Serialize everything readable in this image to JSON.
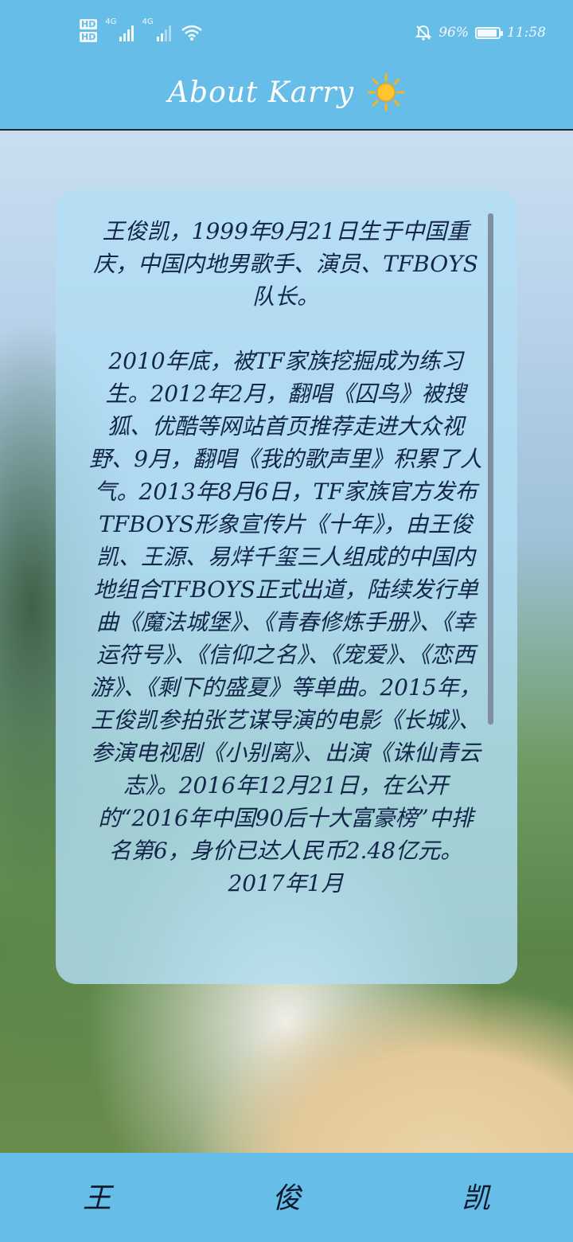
{
  "status_bar": {
    "hd1": "HD",
    "hd2": "HD",
    "net1": "4G",
    "net2": "4G",
    "battery_percent": "96%",
    "time": "11:58",
    "battery_level": 0.96
  },
  "app_bar": {
    "title": "About Karry",
    "icon": "sun-icon"
  },
  "content": {
    "paragraph1": "王俊凯，1999年9月21日生于中国重庆，中国内地男歌手、演员、TFBOYS队长。",
    "paragraph2": "2010年底，被TF家族挖掘成为练习生。2012年2月，翻唱《囚鸟》被搜狐、优酷等网站首页推荐走进大众视野、9月，翻唱《我的歌声里》积累了人气。2013年8月6日，TF家族官方发布TFBOYS形象宣传片《十年》，由王俊凯、王源、易烊千玺三人组成的中国内地组合TFBOYS正式出道，陆续发行单曲《魔法城堡》、《青春修炼手册》、《幸运符号》、《信仰之名》、《宠爱》、《恋西游》、《剩下的盛夏》等单曲。2015年，王俊凯参拍张艺谋导演的电影《长城》、参演电视剧《小别离》、出演《诛仙青云志》。2016年12月21日，在公开的“2016年中国90后十大富豪榜”中排名第6，身价已达人民币2.48亿元。2017年1月"
  },
  "bottom_bar": {
    "char1": "王",
    "char2": "俊",
    "char3": "凯"
  },
  "colors": {
    "bar_blue": "#66bde8",
    "card_blue": "#b2dff5",
    "text_navy": "#12264a"
  }
}
